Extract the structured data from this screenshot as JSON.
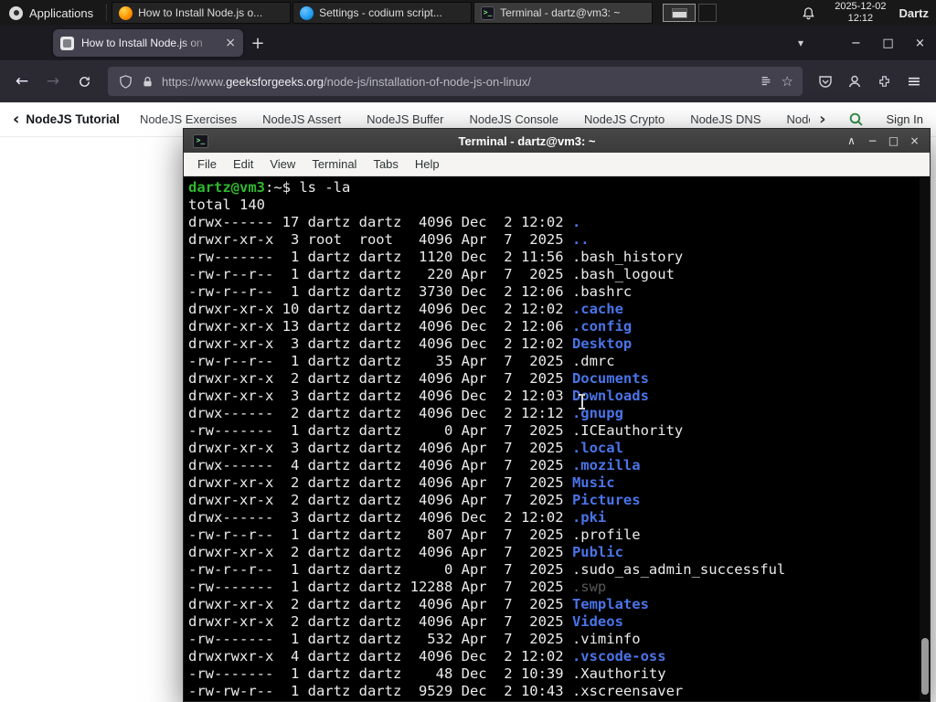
{
  "colors": {
    "panel_bg": "#181818",
    "tabbar_bg": "#1c1b22",
    "toolbar_bg": "#2b2a33",
    "urlbar_bg": "#42414d",
    "terminal_bg": "#000000",
    "prompt_green": "#2eb82e",
    "directory_blue": "#4a74e8",
    "dim_grey": "#585858",
    "gfg_green": "#2f8d46"
  },
  "glyphs": {
    "back": "←",
    "forward": "→",
    "menu": "≡",
    "star": "☆",
    "new_tab": "+",
    "tab_list": "▾",
    "minimize": "−",
    "maximize": "□",
    "close": "×",
    "shade": "∧",
    "tab_close": "×",
    "chevron_left": "‹",
    "chevron_right": "›",
    "terminal_prompt_glyph": ">_"
  },
  "panel": {
    "applications_label": "Applications",
    "taskbar": [
      {
        "title": "How to Install Node.js o...",
        "icon": "firefox"
      },
      {
        "title": "Settings - codium script...",
        "icon": "codium"
      },
      {
        "title": "Terminal - dartz@vm3: ~",
        "icon": "terminal"
      }
    ],
    "clock_date": "2025-12-02",
    "clock_time": "12:12",
    "user": "Dartz"
  },
  "browser": {
    "tab_title": "How to Install Node.js on",
    "url_protocol": "https://www.",
    "url_domain": "geeksforgeeks.org",
    "url_path": "/node-js/installation-of-node-js-on-linux/"
  },
  "sitenav": {
    "back_label": "NodeJS Tutorial",
    "items": [
      "NodeJS Exercises",
      "NodeJS Assert",
      "NodeJS Buffer",
      "NodeJS Console",
      "NodeJS Crypto",
      "NodeJS DNS",
      "Node"
    ],
    "sign_in": "Sign In"
  },
  "terminal": {
    "window_title": "Terminal - dartz@vm3: ~",
    "menu": [
      "File",
      "Edit",
      "View",
      "Terminal",
      "Tabs",
      "Help"
    ],
    "prompt_user": "dartz@vm3",
    "prompt_suffix": ":~$",
    "command": "ls -la",
    "total_line": "total 140",
    "entries": [
      {
        "p": "drwx------",
        "n": 17,
        "o": "dartz",
        "g": "dartz",
        "s": 4096,
        "m": "Dec",
        "d": 2,
        "t": "12:02",
        "f": ".",
        "c": "dir"
      },
      {
        "p": "drwxr-xr-x",
        "n": 3,
        "o": "root",
        "g": "root",
        "s": 4096,
        "m": "Apr",
        "d": 7,
        "t": "2025",
        "f": "..",
        "c": "dir"
      },
      {
        "p": "-rw-------",
        "n": 1,
        "o": "dartz",
        "g": "dartz",
        "s": 1120,
        "m": "Dec",
        "d": 2,
        "t": "11:56",
        "f": ".bash_history",
        "c": "file"
      },
      {
        "p": "-rw-r--r--",
        "n": 1,
        "o": "dartz",
        "g": "dartz",
        "s": 220,
        "m": "Apr",
        "d": 7,
        "t": "2025",
        "f": ".bash_logout",
        "c": "file"
      },
      {
        "p": "-rw-r--r--",
        "n": 1,
        "o": "dartz",
        "g": "dartz",
        "s": 3730,
        "m": "Dec",
        "d": 2,
        "t": "12:06",
        "f": ".bashrc",
        "c": "file"
      },
      {
        "p": "drwxr-xr-x",
        "n": 10,
        "o": "dartz",
        "g": "dartz",
        "s": 4096,
        "m": "Dec",
        "d": 2,
        "t": "12:02",
        "f": ".cache",
        "c": "dir"
      },
      {
        "p": "drwxr-xr-x",
        "n": 13,
        "o": "dartz",
        "g": "dartz",
        "s": 4096,
        "m": "Dec",
        "d": 2,
        "t": "12:06",
        "f": ".config",
        "c": "dir"
      },
      {
        "p": "drwxr-xr-x",
        "n": 3,
        "o": "dartz",
        "g": "dartz",
        "s": 4096,
        "m": "Dec",
        "d": 2,
        "t": "12:02",
        "f": "Desktop",
        "c": "dir"
      },
      {
        "p": "-rw-r--r--",
        "n": 1,
        "o": "dartz",
        "g": "dartz",
        "s": 35,
        "m": "Apr",
        "d": 7,
        "t": "2025",
        "f": ".dmrc",
        "c": "file"
      },
      {
        "p": "drwxr-xr-x",
        "n": 2,
        "o": "dartz",
        "g": "dartz",
        "s": 4096,
        "m": "Apr",
        "d": 7,
        "t": "2025",
        "f": "Documents",
        "c": "dir"
      },
      {
        "p": "drwxr-xr-x",
        "n": 3,
        "o": "dartz",
        "g": "dartz",
        "s": 4096,
        "m": "Dec",
        "d": 2,
        "t": "12:03",
        "f": "Downloads",
        "c": "dir"
      },
      {
        "p": "drwx------",
        "n": 2,
        "o": "dartz",
        "g": "dartz",
        "s": 4096,
        "m": "Dec",
        "d": 2,
        "t": "12:12",
        "f": ".gnupg",
        "c": "dir"
      },
      {
        "p": "-rw-------",
        "n": 1,
        "o": "dartz",
        "g": "dartz",
        "s": 0,
        "m": "Apr",
        "d": 7,
        "t": "2025",
        "f": ".ICEauthority",
        "c": "file"
      },
      {
        "p": "drwxr-xr-x",
        "n": 3,
        "o": "dartz",
        "g": "dartz",
        "s": 4096,
        "m": "Apr",
        "d": 7,
        "t": "2025",
        "f": ".local",
        "c": "dir"
      },
      {
        "p": "drwx------",
        "n": 4,
        "o": "dartz",
        "g": "dartz",
        "s": 4096,
        "m": "Apr",
        "d": 7,
        "t": "2025",
        "f": ".mozilla",
        "c": "dir"
      },
      {
        "p": "drwxr-xr-x",
        "n": 2,
        "o": "dartz",
        "g": "dartz",
        "s": 4096,
        "m": "Apr",
        "d": 7,
        "t": "2025",
        "f": "Music",
        "c": "dir"
      },
      {
        "p": "drwxr-xr-x",
        "n": 2,
        "o": "dartz",
        "g": "dartz",
        "s": 4096,
        "m": "Apr",
        "d": 7,
        "t": "2025",
        "f": "Pictures",
        "c": "dir"
      },
      {
        "p": "drwx------",
        "n": 3,
        "o": "dartz",
        "g": "dartz",
        "s": 4096,
        "m": "Dec",
        "d": 2,
        "t": "12:02",
        "f": ".pki",
        "c": "dir"
      },
      {
        "p": "-rw-r--r--",
        "n": 1,
        "o": "dartz",
        "g": "dartz",
        "s": 807,
        "m": "Apr",
        "d": 7,
        "t": "2025",
        "f": ".profile",
        "c": "file"
      },
      {
        "p": "drwxr-xr-x",
        "n": 2,
        "o": "dartz",
        "g": "dartz",
        "s": 4096,
        "m": "Apr",
        "d": 7,
        "t": "2025",
        "f": "Public",
        "c": "dir"
      },
      {
        "p": "-rw-r--r--",
        "n": 1,
        "o": "dartz",
        "g": "dartz",
        "s": 0,
        "m": "Apr",
        "d": 7,
        "t": "2025",
        "f": ".sudo_as_admin_successful",
        "c": "file"
      },
      {
        "p": "-rw-------",
        "n": 1,
        "o": "dartz",
        "g": "dartz",
        "s": 12288,
        "m": "Apr",
        "d": 7,
        "t": "2025",
        "f": ".swp",
        "c": "dim"
      },
      {
        "p": "drwxr-xr-x",
        "n": 2,
        "o": "dartz",
        "g": "dartz",
        "s": 4096,
        "m": "Apr",
        "d": 7,
        "t": "2025",
        "f": "Templates",
        "c": "dir"
      },
      {
        "p": "drwxr-xr-x",
        "n": 2,
        "o": "dartz",
        "g": "dartz",
        "s": 4096,
        "m": "Apr",
        "d": 7,
        "t": "2025",
        "f": "Videos",
        "c": "dir"
      },
      {
        "p": "-rw-------",
        "n": 1,
        "o": "dartz",
        "g": "dartz",
        "s": 532,
        "m": "Apr",
        "d": 7,
        "t": "2025",
        "f": ".viminfo",
        "c": "file"
      },
      {
        "p": "drwxrwxr-x",
        "n": 4,
        "o": "dartz",
        "g": "dartz",
        "s": 4096,
        "m": "Dec",
        "d": 2,
        "t": "12:02",
        "f": ".vscode-oss",
        "c": "dir"
      },
      {
        "p": "-rw-------",
        "n": 1,
        "o": "dartz",
        "g": "dartz",
        "s": 48,
        "m": "Dec",
        "d": 2,
        "t": "10:39",
        "f": ".Xauthority",
        "c": "file"
      },
      {
        "p": "-rw-rw-r--",
        "n": 1,
        "o": "dartz",
        "g": "dartz",
        "s": 9529,
        "m": "Dec",
        "d": 2,
        "t": "10:43",
        "f": ".xscreensaver",
        "c": "file"
      }
    ]
  }
}
